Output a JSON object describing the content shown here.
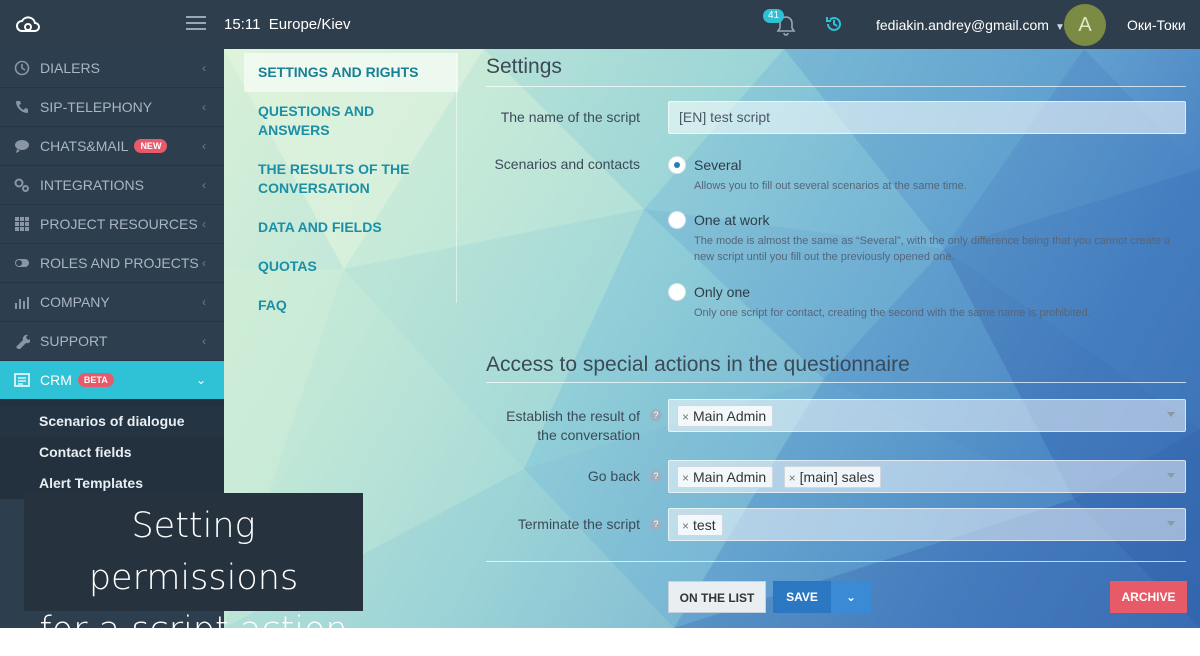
{
  "topbar": {
    "time": "15:11",
    "timezone": "Europe/Kiev",
    "notifications_count": "41",
    "email": "fediakin.andrey@gmail.com",
    "avatar_letter": "A",
    "org": "Оки-Токи"
  },
  "sidebar": {
    "items": [
      {
        "label": "DIALERS",
        "icon": "clock-icon"
      },
      {
        "label": "SIP-TELEPHONY",
        "icon": "phone-icon"
      },
      {
        "label": "CHATS&MAIL",
        "icon": "chat-icon",
        "badge": "NEW"
      },
      {
        "label": "INTEGRATIONS",
        "icon": "gears-icon"
      },
      {
        "label": "PROJECT RESOURCES",
        "icon": "grid-icon"
      },
      {
        "label": "ROLES AND PROJECTS",
        "icon": "toggle-icon"
      },
      {
        "label": "COMPANY",
        "icon": "bar-chart-icon"
      },
      {
        "label": "SUPPORT",
        "icon": "wrench-icon"
      }
    ],
    "active": {
      "label": "CRM",
      "badge": "BETA",
      "icon": "list-icon"
    },
    "sub_items": [
      "Scenarios of dialogue",
      "Contact fields",
      "Alert Templates"
    ]
  },
  "caption": {
    "line1": "Setting permissions",
    "line2": "for a script action"
  },
  "subnav": [
    "SETTINGS AND RIGHTS",
    "QUESTIONS AND ANSWERS",
    "THE RESULTS OF THE CONVERSATION",
    "DATA AND FIELDS",
    "QUOTAS",
    "FAQ"
  ],
  "settings": {
    "title": "Settings",
    "name_label": "The name of the script",
    "name_value": "[EN] test script",
    "scenarios_label": "Scenarios and contacts",
    "options": [
      {
        "label": "Several",
        "desc": "Allows you to fill out several scenarios at the same time.",
        "selected": true
      },
      {
        "label": "One at work",
        "desc": "The mode is almost the same as “Several”, with the only difference being that you cannot create a new script until you fill out the previously opened one.",
        "selected": false
      },
      {
        "label": "Only one",
        "desc": "Only one script for contact, creating the second with the same name is prohibited.",
        "selected": false
      }
    ]
  },
  "access": {
    "title": "Access to special actions in the questionnaire",
    "rows": [
      {
        "label": "Establish the result of the conversation",
        "tags": [
          "Main Admin"
        ]
      },
      {
        "label": "Go back",
        "tags": [
          "Main Admin",
          "[main] sales"
        ]
      },
      {
        "label": "Terminate the script",
        "tags": [
          "test"
        ]
      }
    ]
  },
  "buttons": {
    "list": "ON THE LIST",
    "save": "SAVE",
    "archive": "ARCHIVE"
  },
  "colors": {
    "topbar": "#2f3e4d",
    "sidebar": "#2d3e4f",
    "accent": "#2fc1d6",
    "save": "#2b77c2",
    "archive": "#e75a67"
  }
}
